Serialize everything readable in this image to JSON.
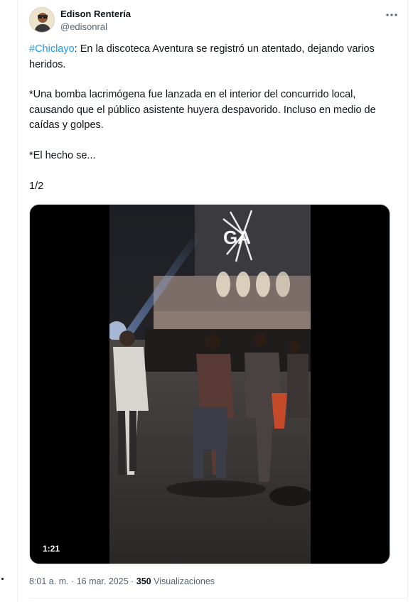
{
  "tweet": {
    "author_name": "Edison Rentería",
    "author_handle": "@edisonral",
    "more_icon": "more-horizontal-icon",
    "hashtag": "#Chiclayo",
    "text_after_hashtag": ": En la discoteca Aventura se registró un atentado, dejando varios heridos.",
    "paragraph_2": "*Una bomba lacrimógena fue lanzada en el interior del concurrido local, causando que el público asistente huyera despavorido. Incluso en medio de caídas y golpes.",
    "paragraph_3": "*El hecho se...",
    "paragraph_4": "1/2",
    "video": {
      "duration": "1:21"
    },
    "timestamp": "8:01 a. m. · 16 mar. 2025",
    "separator": " · ",
    "views_count": "350",
    "views_label": " Visualizaciones"
  },
  "colors": {
    "link": "#1d9bf0",
    "secondary_text": "#536471",
    "primary_text": "#0f1419"
  }
}
